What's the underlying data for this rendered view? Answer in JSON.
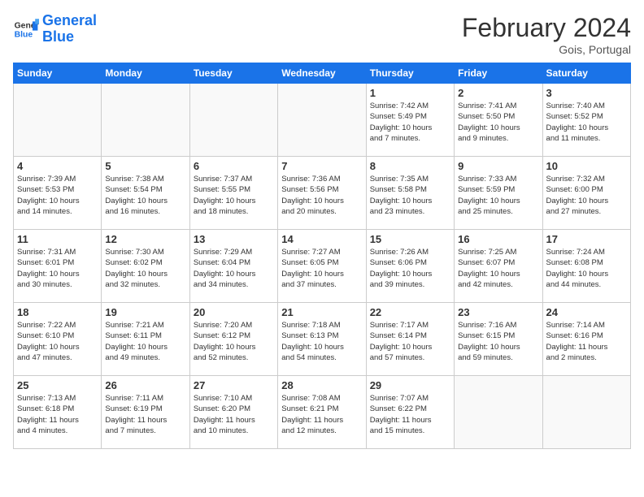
{
  "header": {
    "logo_line1": "General",
    "logo_line2": "Blue",
    "month_title": "February 2024",
    "location": "Gois, Portugal"
  },
  "weekdays": [
    "Sunday",
    "Monday",
    "Tuesday",
    "Wednesday",
    "Thursday",
    "Friday",
    "Saturday"
  ],
  "weeks": [
    [
      {
        "day": "",
        "info": "",
        "empty": true
      },
      {
        "day": "",
        "info": "",
        "empty": true
      },
      {
        "day": "",
        "info": "",
        "empty": true
      },
      {
        "day": "",
        "info": "",
        "empty": true
      },
      {
        "day": "1",
        "info": "Sunrise: 7:42 AM\nSunset: 5:49 PM\nDaylight: 10 hours\nand 7 minutes.",
        "empty": false
      },
      {
        "day": "2",
        "info": "Sunrise: 7:41 AM\nSunset: 5:50 PM\nDaylight: 10 hours\nand 9 minutes.",
        "empty": false
      },
      {
        "day": "3",
        "info": "Sunrise: 7:40 AM\nSunset: 5:52 PM\nDaylight: 10 hours\nand 11 minutes.",
        "empty": false
      }
    ],
    [
      {
        "day": "4",
        "info": "Sunrise: 7:39 AM\nSunset: 5:53 PM\nDaylight: 10 hours\nand 14 minutes.",
        "empty": false
      },
      {
        "day": "5",
        "info": "Sunrise: 7:38 AM\nSunset: 5:54 PM\nDaylight: 10 hours\nand 16 minutes.",
        "empty": false
      },
      {
        "day": "6",
        "info": "Sunrise: 7:37 AM\nSunset: 5:55 PM\nDaylight: 10 hours\nand 18 minutes.",
        "empty": false
      },
      {
        "day": "7",
        "info": "Sunrise: 7:36 AM\nSunset: 5:56 PM\nDaylight: 10 hours\nand 20 minutes.",
        "empty": false
      },
      {
        "day": "8",
        "info": "Sunrise: 7:35 AM\nSunset: 5:58 PM\nDaylight: 10 hours\nand 23 minutes.",
        "empty": false
      },
      {
        "day": "9",
        "info": "Sunrise: 7:33 AM\nSunset: 5:59 PM\nDaylight: 10 hours\nand 25 minutes.",
        "empty": false
      },
      {
        "day": "10",
        "info": "Sunrise: 7:32 AM\nSunset: 6:00 PM\nDaylight: 10 hours\nand 27 minutes.",
        "empty": false
      }
    ],
    [
      {
        "day": "11",
        "info": "Sunrise: 7:31 AM\nSunset: 6:01 PM\nDaylight: 10 hours\nand 30 minutes.",
        "empty": false
      },
      {
        "day": "12",
        "info": "Sunrise: 7:30 AM\nSunset: 6:02 PM\nDaylight: 10 hours\nand 32 minutes.",
        "empty": false
      },
      {
        "day": "13",
        "info": "Sunrise: 7:29 AM\nSunset: 6:04 PM\nDaylight: 10 hours\nand 34 minutes.",
        "empty": false
      },
      {
        "day": "14",
        "info": "Sunrise: 7:27 AM\nSunset: 6:05 PM\nDaylight: 10 hours\nand 37 minutes.",
        "empty": false
      },
      {
        "day": "15",
        "info": "Sunrise: 7:26 AM\nSunset: 6:06 PM\nDaylight: 10 hours\nand 39 minutes.",
        "empty": false
      },
      {
        "day": "16",
        "info": "Sunrise: 7:25 AM\nSunset: 6:07 PM\nDaylight: 10 hours\nand 42 minutes.",
        "empty": false
      },
      {
        "day": "17",
        "info": "Sunrise: 7:24 AM\nSunset: 6:08 PM\nDaylight: 10 hours\nand 44 minutes.",
        "empty": false
      }
    ],
    [
      {
        "day": "18",
        "info": "Sunrise: 7:22 AM\nSunset: 6:10 PM\nDaylight: 10 hours\nand 47 minutes.",
        "empty": false
      },
      {
        "day": "19",
        "info": "Sunrise: 7:21 AM\nSunset: 6:11 PM\nDaylight: 10 hours\nand 49 minutes.",
        "empty": false
      },
      {
        "day": "20",
        "info": "Sunrise: 7:20 AM\nSunset: 6:12 PM\nDaylight: 10 hours\nand 52 minutes.",
        "empty": false
      },
      {
        "day": "21",
        "info": "Sunrise: 7:18 AM\nSunset: 6:13 PM\nDaylight: 10 hours\nand 54 minutes.",
        "empty": false
      },
      {
        "day": "22",
        "info": "Sunrise: 7:17 AM\nSunset: 6:14 PM\nDaylight: 10 hours\nand 57 minutes.",
        "empty": false
      },
      {
        "day": "23",
        "info": "Sunrise: 7:16 AM\nSunset: 6:15 PM\nDaylight: 10 hours\nand 59 minutes.",
        "empty": false
      },
      {
        "day": "24",
        "info": "Sunrise: 7:14 AM\nSunset: 6:16 PM\nDaylight: 11 hours\nand 2 minutes.",
        "empty": false
      }
    ],
    [
      {
        "day": "25",
        "info": "Sunrise: 7:13 AM\nSunset: 6:18 PM\nDaylight: 11 hours\nand 4 minutes.",
        "empty": false
      },
      {
        "day": "26",
        "info": "Sunrise: 7:11 AM\nSunset: 6:19 PM\nDaylight: 11 hours\nand 7 minutes.",
        "empty": false
      },
      {
        "day": "27",
        "info": "Sunrise: 7:10 AM\nSunset: 6:20 PM\nDaylight: 11 hours\nand 10 minutes.",
        "empty": false
      },
      {
        "day": "28",
        "info": "Sunrise: 7:08 AM\nSunset: 6:21 PM\nDaylight: 11 hours\nand 12 minutes.",
        "empty": false
      },
      {
        "day": "29",
        "info": "Sunrise: 7:07 AM\nSunset: 6:22 PM\nDaylight: 11 hours\nand 15 minutes.",
        "empty": false
      },
      {
        "day": "",
        "info": "",
        "empty": true
      },
      {
        "day": "",
        "info": "",
        "empty": true
      }
    ]
  ]
}
